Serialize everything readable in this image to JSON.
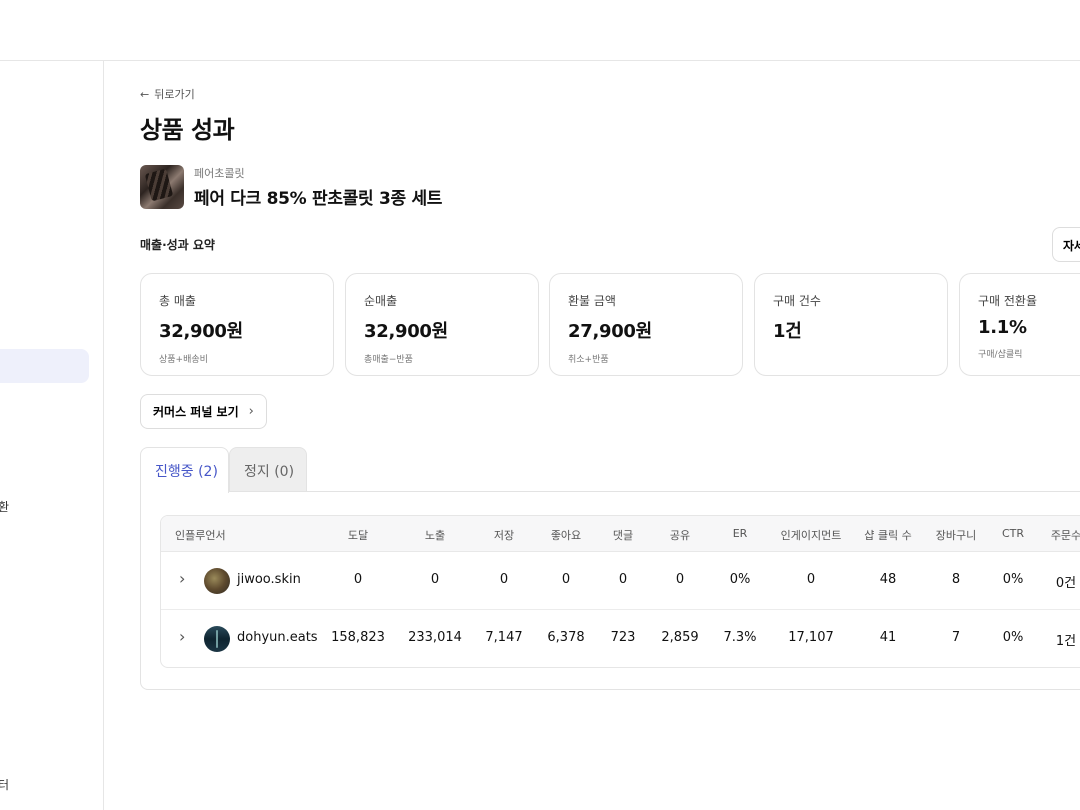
{
  "sidebar": {
    "frag1": "환",
    "frag2": "터"
  },
  "header": {
    "back_label": "뒤로가기",
    "title": "상품 성과"
  },
  "product": {
    "brand": "페어초콜릿",
    "name": "페어 다크 85% 판초콜릿 3종 세트"
  },
  "summary": {
    "section_label": "매출·성과 요약",
    "detail_button": "자세히"
  },
  "cards": [
    {
      "label": "총 매출",
      "value": "32,900원",
      "sub": "상품+배송비"
    },
    {
      "label": "순매출",
      "value": "32,900원",
      "sub": "총매출−반품"
    },
    {
      "label": "환불 금액",
      "value": "27,900원",
      "sub": "취소+반품"
    },
    {
      "label": "구매 건수",
      "value": "1건",
      "sub": ""
    },
    {
      "label": "구매 전환율",
      "value": "1.1%",
      "sub": "구매/샵클릭"
    }
  ],
  "funnel_button": "커머스 퍼널 보기",
  "tabs": {
    "active": "진행중 (2)",
    "inactive": "정지 (0)"
  },
  "table": {
    "headers": [
      "인플루언서",
      "도달",
      "노출",
      "저장",
      "좋아요",
      "댓글",
      "공유",
      "ER",
      "인게이지먼트",
      "샵 클릭 수",
      "장바구니",
      "CTR",
      "주문수"
    ],
    "rows": [
      {
        "handle": "jiwoo.skin",
        "cells": [
          "0",
          "0",
          "0",
          "0",
          "0",
          "0",
          "0%",
          "0",
          "48",
          "8",
          "0%",
          "0건"
        ]
      },
      {
        "handle": "dohyun.eats",
        "cells": [
          "158,823",
          "233,014",
          "7,147",
          "6,378",
          "723",
          "2,859",
          "7.3%",
          "17,107",
          "41",
          "7",
          "0%",
          "1건"
        ]
      }
    ]
  }
}
